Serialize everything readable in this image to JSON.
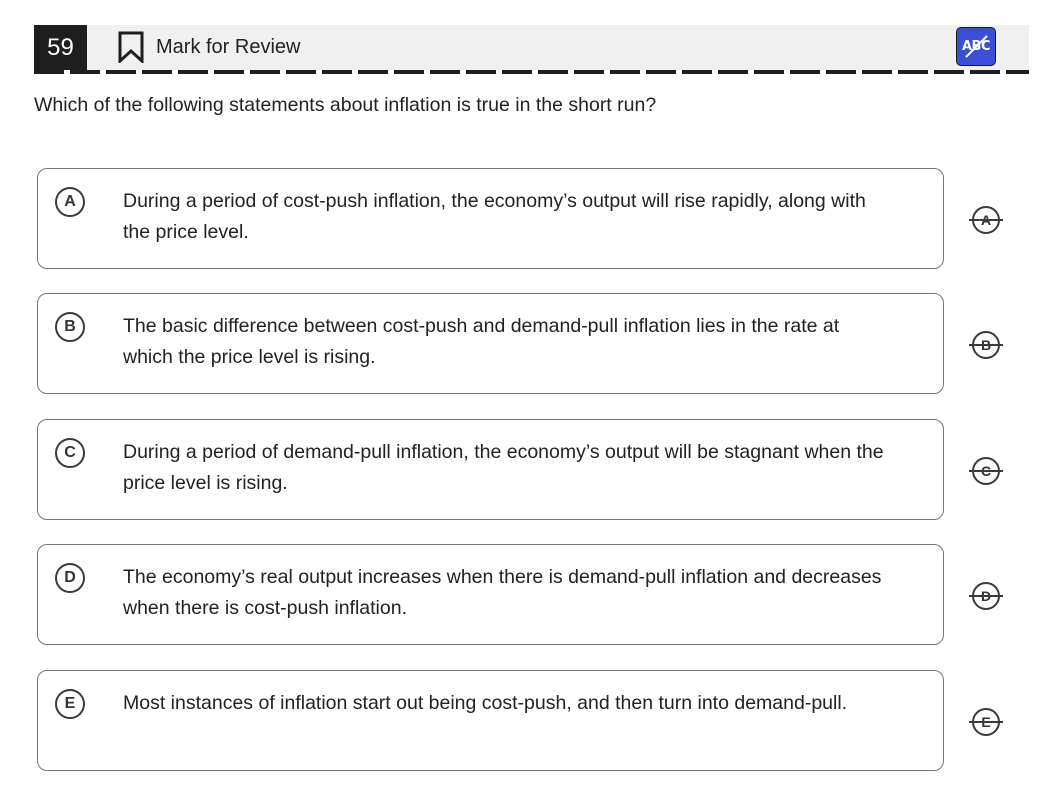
{
  "header": {
    "question_number": "59",
    "mark_for_review_label": "Mark for Review",
    "abc_toggle_label": "ABC",
    "abc_toggle_color": "#3b4fd6"
  },
  "question": {
    "text": "Which of the following statements about inflation is true in the short run?"
  },
  "choices": [
    {
      "letter": "A",
      "text": "During a period of cost-push inflation, the economy’s output will rise rapidly, along with the price level."
    },
    {
      "letter": "B",
      "text": "The basic difference between cost-push and demand-pull inflation lies in the rate at which the price level is rising."
    },
    {
      "letter": "C",
      "text": "During a period of demand-pull inflation, the economy’s output will be stagnant when the price level is rising."
    },
    {
      "letter": "D",
      "text": "The economy’s real output increases when there is demand-pull inflation and decreases when there is cost-push inflation."
    },
    {
      "letter": "E",
      "text": "Most instances of inflation start out being cost-push, and then turn into demand-pull."
    }
  ]
}
